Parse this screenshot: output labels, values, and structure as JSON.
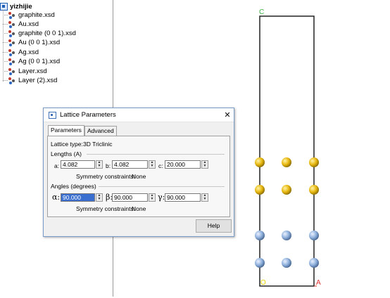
{
  "tree": {
    "root": "yizhijie",
    "items": [
      {
        "label": "graphite.xsd"
      },
      {
        "label": "Au.xsd"
      },
      {
        "label": "graphite (0 0 1).xsd"
      },
      {
        "label": "Au (0 0 1).xsd"
      },
      {
        "label": "Ag.xsd"
      },
      {
        "label": "Ag (0 0 1).xsd"
      },
      {
        "label": "Layer.xsd"
      },
      {
        "label": "Layer (2).xsd"
      }
    ]
  },
  "dialog": {
    "title": "Lattice Parameters",
    "close_symbol": "✕",
    "tabs": [
      {
        "label": "Parameters",
        "active": true
      },
      {
        "label": "Advanced",
        "active": false
      }
    ],
    "lattice_type_label": "Lattice type:",
    "lattice_type_value": "3D Triclinic",
    "lengths": {
      "group_label": "Lengths (A)",
      "a_label": "a:",
      "a_value": "4.082",
      "b_label": "b:",
      "b_value": "4.082",
      "c_label": "c:",
      "c_value": "20.000",
      "symmetry_label": "Symmetry constraints:",
      "symmetry_value": "None"
    },
    "angles": {
      "group_label": "Angles (degrees)",
      "alpha_label": "α:",
      "alpha_value": "90.000",
      "beta_label": "β:",
      "beta_value": "90.000",
      "gamma_label": "γ:",
      "gamma_value": "90.000",
      "symmetry_label": "Symmetry constraints:",
      "symmetry_value": "None"
    },
    "help_label": "Help"
  },
  "viewer": {
    "axis_c": "C",
    "axis_a": "A",
    "axis_origin": "O",
    "colors": {
      "gold": "#e8b80f",
      "silver": "#8fb0dc",
      "cell": "#222222",
      "axis_c": "#3cb043",
      "axis_a": "#e03030",
      "axis_o": "#e8d000"
    }
  }
}
